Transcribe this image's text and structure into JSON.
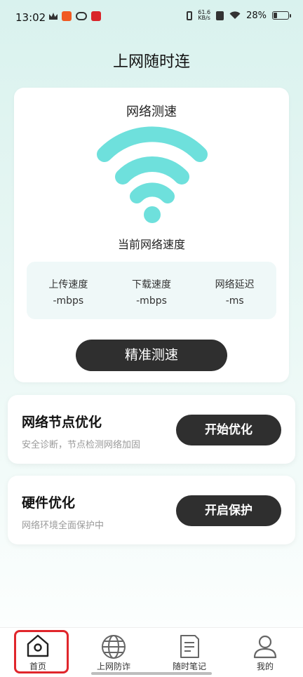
{
  "status_bar": {
    "time": "13:02",
    "net_speed_top": "61.6",
    "net_speed_unit": "KB/s",
    "battery": "28%",
    "battery_level": 0.28
  },
  "page_title": "上网随时连",
  "speed_card": {
    "title": "网络测速",
    "subtitle": "当前网络速度",
    "stats": [
      {
        "label": "上传速度",
        "value": "-mbps"
      },
      {
        "label": "下载速度",
        "value": "-mbps"
      },
      {
        "label": "网络延迟",
        "value": "-ms"
      }
    ],
    "button_label": "精准测速",
    "wifi_color": "#6ee0dc"
  },
  "options": [
    {
      "title": "网络节点优化",
      "desc": "安全诊断，节点检测网络加固",
      "button": "开始优化"
    },
    {
      "title": "硬件优化",
      "desc": "网络环境全面保护中",
      "button": "开启保护"
    }
  ],
  "tabs": [
    {
      "label": "首页",
      "icon": "home-icon"
    },
    {
      "label": "上网防诈",
      "icon": "globe-icon"
    },
    {
      "label": "随时笔记",
      "icon": "note-icon"
    },
    {
      "label": "我的",
      "icon": "user-icon"
    }
  ]
}
